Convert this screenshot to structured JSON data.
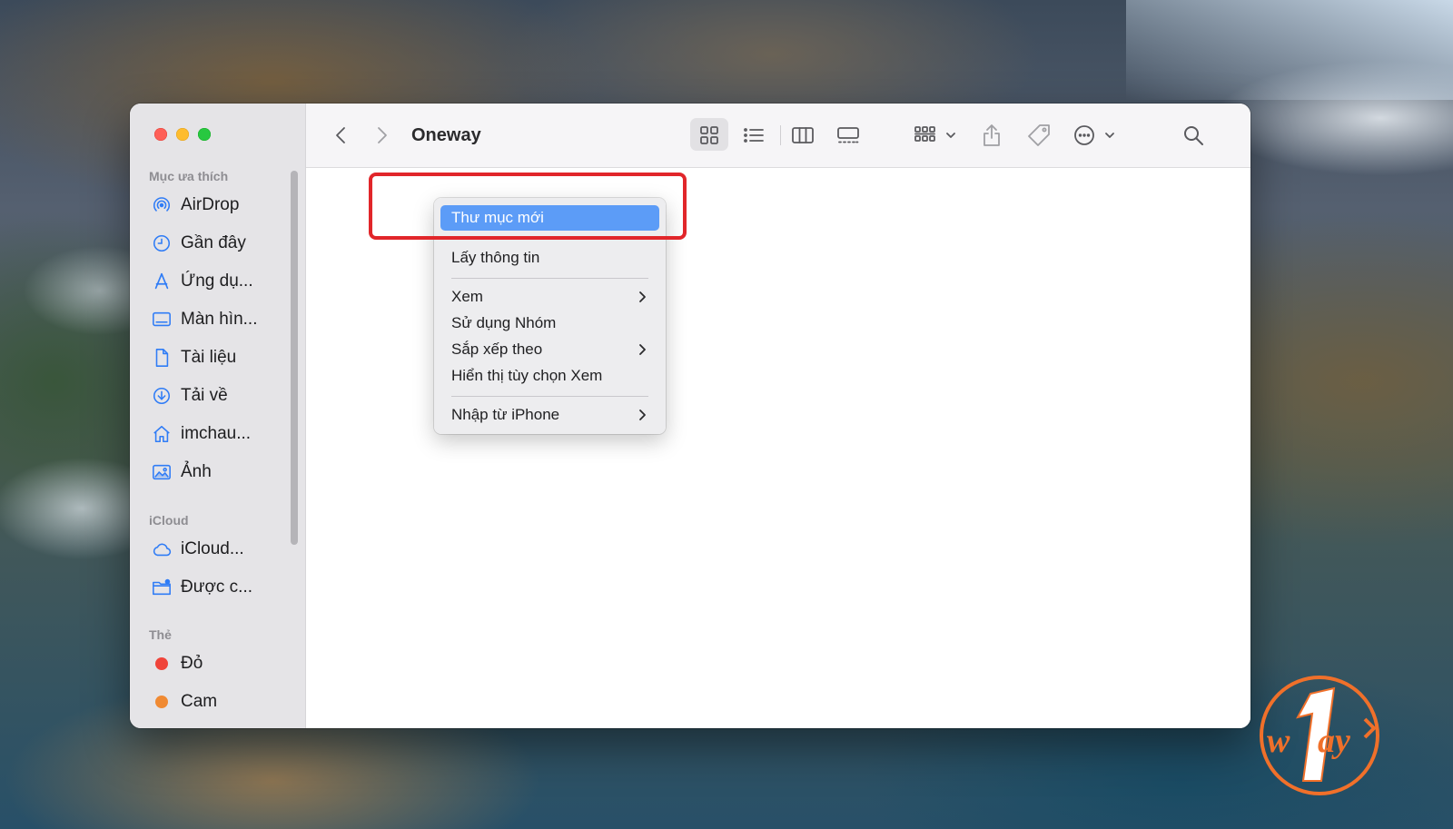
{
  "window": {
    "title": "Oneway"
  },
  "sidebar": {
    "sections": [
      {
        "label": "Mục ưa thích"
      },
      {
        "label": "iCloud"
      },
      {
        "label": "Thẻ"
      }
    ],
    "favorites": [
      {
        "label": "AirDrop",
        "icon": "airdrop-icon"
      },
      {
        "label": "Gần đây",
        "icon": "clock-icon"
      },
      {
        "label": "Ứng dụ...",
        "icon": "applications-icon"
      },
      {
        "label": "Màn hìn...",
        "icon": "desktop-icon"
      },
      {
        "label": "Tài liệu",
        "icon": "document-icon"
      },
      {
        "label": "Tải về",
        "icon": "download-icon"
      },
      {
        "label": "imchau...",
        "icon": "home-icon"
      },
      {
        "label": "Ảnh",
        "icon": "photos-icon"
      }
    ],
    "icloud": [
      {
        "label": "iCloud...",
        "icon": "cloud-icon"
      },
      {
        "label": "Được c...",
        "icon": "shared-folder-icon"
      }
    ],
    "tags": [
      {
        "label": "Đỏ",
        "color": "#f0443a"
      },
      {
        "label": "Cam",
        "color": "#f08a33"
      }
    ]
  },
  "toolbar": {
    "icons": [
      "back-icon",
      "forward-icon",
      "icon-view-icon",
      "list-view-icon",
      "column-view-icon",
      "gallery-view-icon",
      "group-icon",
      "share-icon",
      "tag-icon",
      "more-icon",
      "search-icon"
    ]
  },
  "context_menu": {
    "items": [
      {
        "label": "Thư mục mới",
        "active": true
      },
      {
        "label": "Lấy thông tin"
      },
      {
        "label": "Xem",
        "submenu": true
      },
      {
        "label": "Sử dụng Nhóm"
      },
      {
        "label": "Sắp xếp theo",
        "submenu": true
      },
      {
        "label": "Hiển thị tùy chọn Xem"
      },
      {
        "label": "Nhập từ iPhone",
        "submenu": true
      }
    ]
  },
  "colors": {
    "accent": "#5c9cf7",
    "highlight_box": "#e1262a",
    "logo": "#f0702a"
  }
}
